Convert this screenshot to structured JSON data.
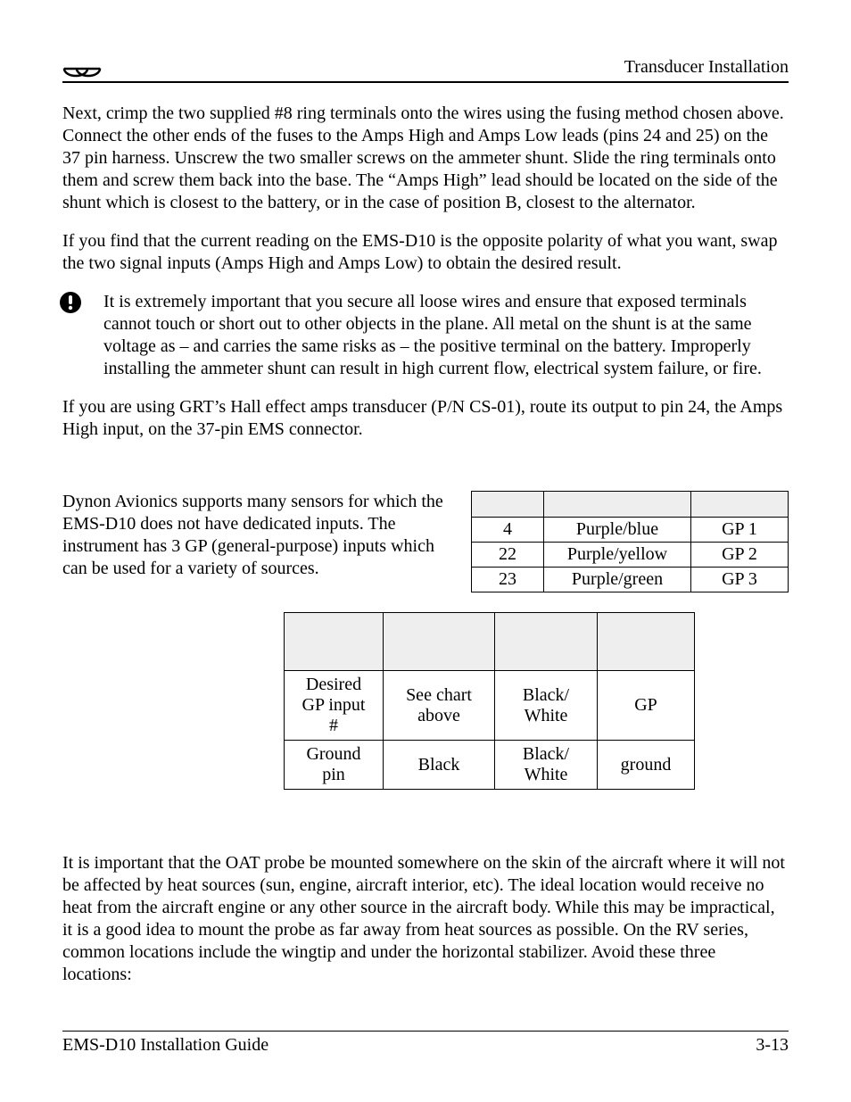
{
  "header": {
    "title_right": "Transducer Installation"
  },
  "para1": "Next, crimp the two supplied #8 ring terminals onto the wires using the fusing method chosen above. Connect the other ends of the fuses to the Amps High and Amps Low leads (pins 24 and 25) on the 37 pin harness. Unscrew the two smaller screws on the ammeter shunt. Slide the ring terminals onto them and screw them back into the base. The “Amps High” lead should be located on the side of the shunt which is closest to the battery, or in the case of position B, closest to the alternator.",
  "para2": "If you find that the current reading on the EMS-D10 is the opposite polarity of what you want, swap the two signal inputs (Amps High and Amps Low) to obtain the desired result.",
  "note": "It is extremely important that you secure all loose wires and ensure that exposed terminals cannot touch or short out to other objects in the plane. All metal on the shunt is at the same voltage as – and carries the same risks as – the positive terminal on the battery. Improperly installing the ammeter shunt can result in high current flow, electrical system failure, or fire.",
  "para3": "If you are using GRT’s Hall effect amps transducer (P/N CS-01), route its output to pin 24, the Amps High input, on the 37-pin EMS connector.",
  "para4": "Dynon Avionics supports many sensors for which the EMS-D10 does not have dedicated inputs. The instrument has 3 GP (general-purpose) inputs which can be used for a variety of sources.",
  "table1": {
    "head": [
      "",
      "",
      ""
    ],
    "rows": [
      [
        "4",
        "Purple/blue",
        "GP 1"
      ],
      [
        "22",
        "Purple/yellow",
        "GP 2"
      ],
      [
        "23",
        "Purple/green",
        "GP 3"
      ]
    ]
  },
  "table2": {
    "head": [
      "",
      "",
      "",
      ""
    ],
    "rows": [
      [
        "Desired GP input #",
        "See chart above",
        "Black/ White",
        "GP"
      ],
      [
        "Ground pin",
        "Black",
        "Black/ White",
        "ground"
      ]
    ]
  },
  "para5": "It is important that the OAT probe be mounted somewhere on the skin of the aircraft where it will not be affected by heat sources (sun, engine, aircraft interior, etc). The ideal location would receive no heat from the aircraft engine or any other source in the aircraft body. While this may be impractical, it is a good idea to mount the probe as far away from heat sources as possible. On the RV series, common locations include the wingtip and under the horizontal stabilizer. Avoid these three locations:",
  "footer": {
    "left": "EMS-D10 Installation Guide",
    "right": "3-13"
  }
}
